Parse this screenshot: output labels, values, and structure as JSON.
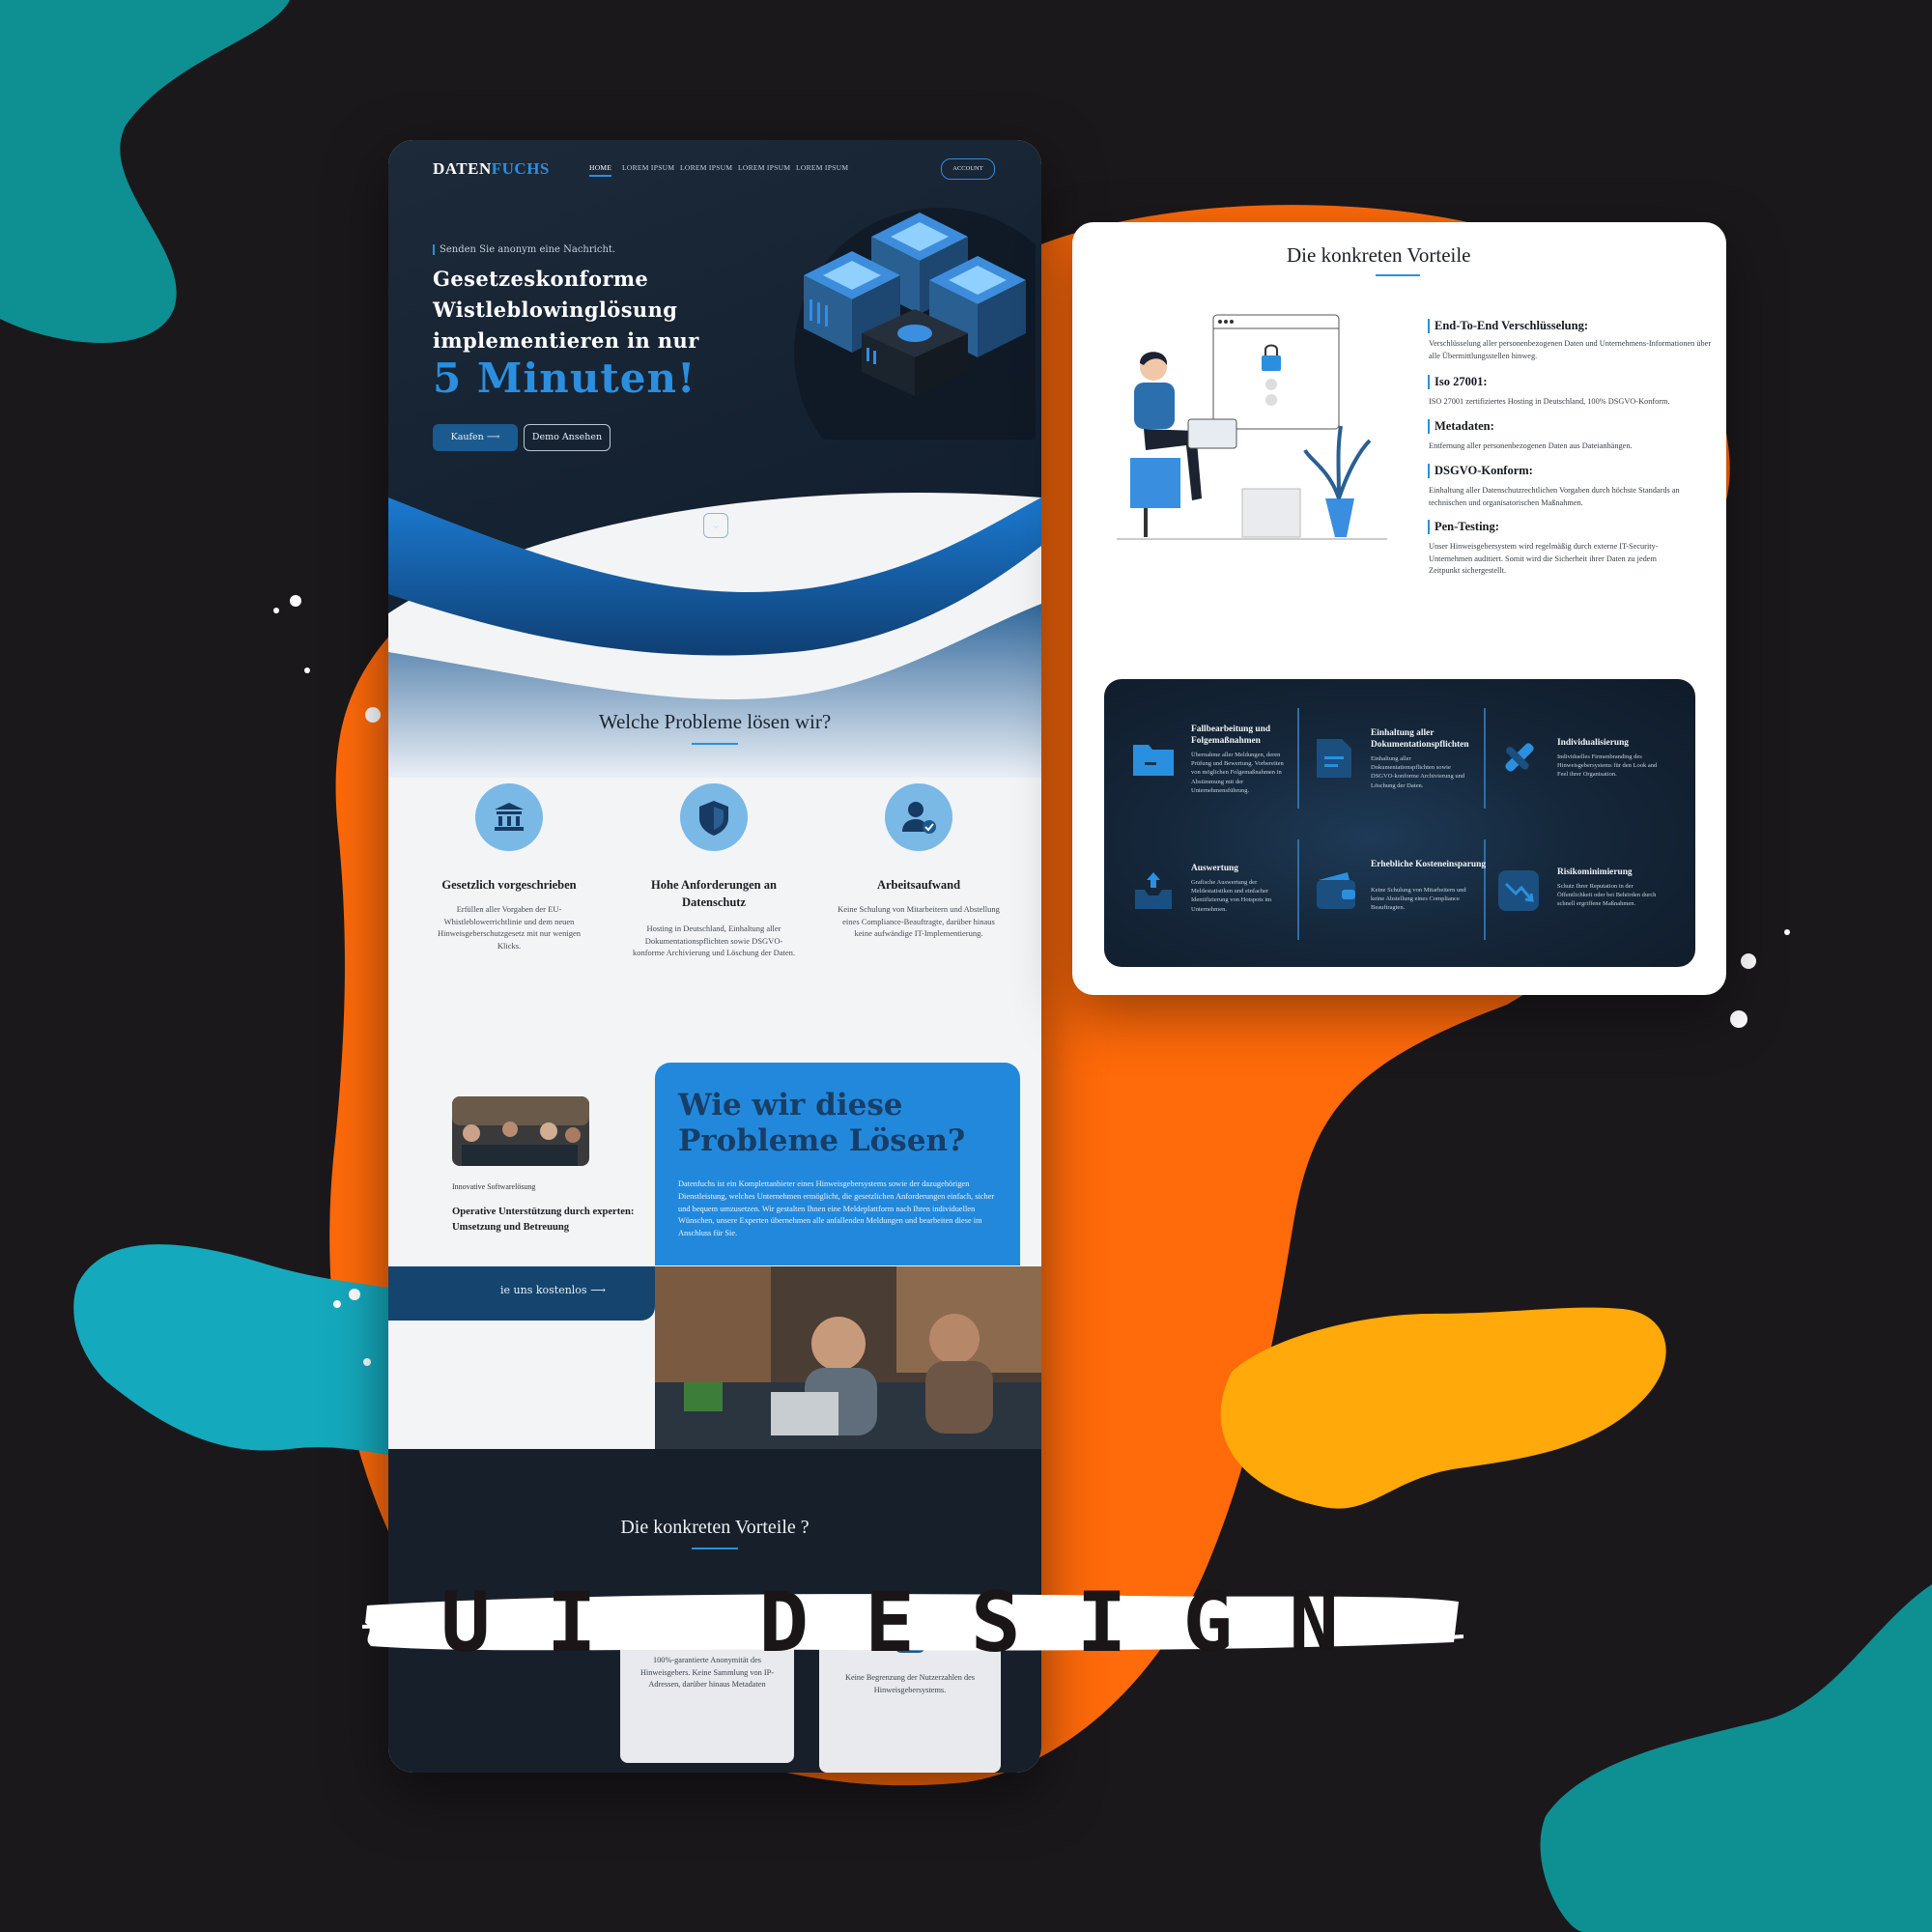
{
  "colors": {
    "accent": "#2b8fe0",
    "orange": "#ff6a0a",
    "teal": "#0e8f92",
    "cyan": "#15a9bd",
    "yellow": "#ffa90a",
    "background": "#1b181b"
  },
  "banner": {
    "text": "UI DESIGN"
  },
  "left": {
    "header": {
      "logo_part1": "DATEN",
      "logo_part2": "FUCHS",
      "nav": [
        "HOME",
        "LOREM IPSUM",
        "LOREM IPSUM",
        "LOREM IPSUM",
        "LOREM IPSUM"
      ],
      "account": "ACCOUNT"
    },
    "hero": {
      "eyebrow": "Senden Sie anonym eine Nachricht.",
      "title_line1": "Gesetzeskonforme",
      "title_line2": "Wistleblowinglösung",
      "title_line3": "implementieren in nur",
      "title_big": "5 Minuten!",
      "btn_primary": "Kaufen ⟶",
      "btn_secondary": "Demo Ansehen",
      "scroll_icon": "chevron-down-icon"
    },
    "problems": {
      "title": "Welche Probleme lösen wir?",
      "items": [
        {
          "icon": "bank-icon",
          "heading": "Gesetzlich vorgeschrieben",
          "text": "Erfüllen aller Vorgaben der EU-Whistleblowerrichtlinie und dem neuen Hinweisgeberschutzgesetz mit nur wenigen Klicks."
        },
        {
          "icon": "shield-icon",
          "heading": "Hohe Anforderungen an Datenschutz",
          "text": "Hosting in Deutschland, Einhaltung aller Dokumentationspflichten sowie DSGVO-konforme Archivierung und Löschung der Daten."
        },
        {
          "icon": "user-check-icon",
          "heading": "Arbeitsaufwand",
          "text": "Keine Schulung von Mitarbeitern und Abstellung eines Compliance-Beauftragte, darüber hinaus keine aufwändige IT-Implementierung."
        }
      ]
    },
    "solution": {
      "label": "Innovative Softwarelösung",
      "subtitle": "Operative Unterstützung durch experten: Umsetzung und Betreuung",
      "card_title": "Wie wir diese Probleme Lösen?",
      "card_text": "Datenfuchs ist ein Komplettanbieter eines Hinweisgebersystems sowie der dazugehörigen Dienstleistung, welches Unternehmen ermöglicht, die gesetzlichen Anforderungen einfach, sicher und bequem umzusetzen. Wir gestalten Ihnen eine Meldeplattform nach Ihren individuellen Wünschen, unsere Experten übernehmen alle anfallenden Meldungen und bearbeiten diese im Anschluss für Sie.",
      "cta": "ie uns kostenlos ⟶"
    },
    "vorteile": {
      "title": "Die konkreten Vorteile ?",
      "cards": [
        {
          "icon": "feather-icon",
          "text": "100%-garantierte Anonymität des Hinweisgebers. Keine Sammlung von IP-Adressen, darüber hinaus Metadaten"
        },
        {
          "icon": "users-icon",
          "text": "Keine Begrenzung der Nutzerzahlen des Hinweisgebersystems."
        }
      ]
    }
  },
  "right": {
    "title": "Die konkreten Vorteile",
    "features": [
      {
        "heading": "End-To-End Verschlüsselung:",
        "text": "Verschlüsselung aller personenbezogenen Daten und Unternehmens-Informationen über alle Übermittlungsstellen hinweg."
      },
      {
        "heading": "Iso 27001:",
        "text": "ISO 27001 zertifiziertes Hosting in Deutschland, 100% DSGVO-Konform."
      },
      {
        "heading": "Metadaten:",
        "text": "Entfernung aller personenbezogenen Daten aus Dateianhängen."
      },
      {
        "heading": "DSGVO-Konform:",
        "text": "Einhaltung aller Datenschutzrechtlichen Vorgaben durch höchste Standards an technischen und organisatorischen Maßnahmen."
      },
      {
        "heading": "Pen-Testing:",
        "text": "Unser Hinweisgebersystem wird regelmäßig durch externe IT-Security-Unternehmen auditiert. Somit wird die Sicherheit ihrer Daten zu jedem Zeitpunkt sichergestellt."
      }
    ],
    "panel": [
      {
        "icon": "folder-icon",
        "title": "Fallbearbeitung und Folgemaßnahmen",
        "text": "Übernahme aller Meldungen, deren Prüfung und Bewertung. Vorbereiten von möglichen Folgemaßnahmen in Abstimmung mit der Unternehmensführung."
      },
      {
        "icon": "document-icon",
        "title": "Einhaltung aller Dokumentationspflichten",
        "text": "Einhaltung aller Dokumentationspflichten sowie DSGVO-konforme Archivierung und Löschung der Daten."
      },
      {
        "icon": "brush-icon",
        "title": "Individualisierung",
        "text": "Individuelles Firmenbranding des Hinweisgebersystems für den Look and Feel ihrer Organisation."
      },
      {
        "icon": "inbox-upload-icon",
        "title": "Auswertung",
        "text": "Grafische Auswertung der Meldestatistiken und einfacher Identifizierung von Hotspots im Unternehmen."
      },
      {
        "icon": "wallet-icon",
        "title": "Erhebliche Kosteneinsparung",
        "text": "Keine Schulung von Mitarbeitern und keine Abstellung eines Compliance Beauftragten."
      },
      {
        "icon": "trend-down-icon",
        "title": "Risikominimierung",
        "text": "Schutz Ihrer Reputation in der Öffentlichkeit oder bei Behörden durch schnell ergriffene Maßnahmen."
      }
    ]
  }
}
